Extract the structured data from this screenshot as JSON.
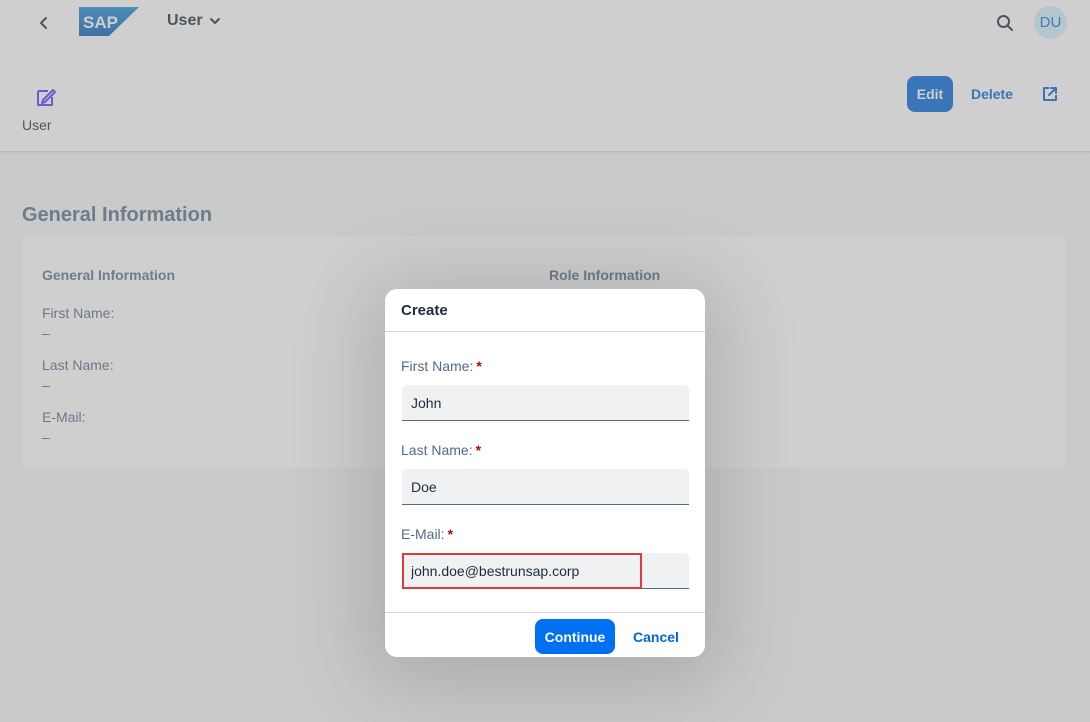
{
  "shell": {
    "logo_text": "SAP",
    "app_title": "User",
    "avatar_initials": "DU"
  },
  "object_header": {
    "title": "User",
    "edit_label": "Edit",
    "delete_label": "Delete"
  },
  "content": {
    "section_title": "General Information",
    "card": {
      "general_heading": "General Information",
      "role_heading": "Role Information",
      "fields": [
        {
          "label": "First Name:",
          "value": "–"
        },
        {
          "label": "Last Name:",
          "value": "–"
        },
        {
          "label": "E-Mail:",
          "value": "–"
        }
      ]
    }
  },
  "dialog": {
    "title": "Create",
    "fields": [
      {
        "label": "First Name:",
        "required": "*",
        "value": "John"
      },
      {
        "label": "Last Name:",
        "required": "*",
        "value": "Doe"
      },
      {
        "label": "E-Mail:",
        "required": "*",
        "value": "john.doe@bestrunsap.corp"
      }
    ],
    "continue_label": "Continue",
    "cancel_label": "Cancel"
  },
  "colors": {
    "brand_blue": "#0070f2",
    "link_blue": "#0064d9",
    "highlight_red": "#e03a3a",
    "required_red": "#aa0808"
  },
  "icons": [
    "back-icon",
    "sap-logo",
    "chevron-down-icon",
    "search-icon",
    "edit-object-icon",
    "share-icon"
  ]
}
